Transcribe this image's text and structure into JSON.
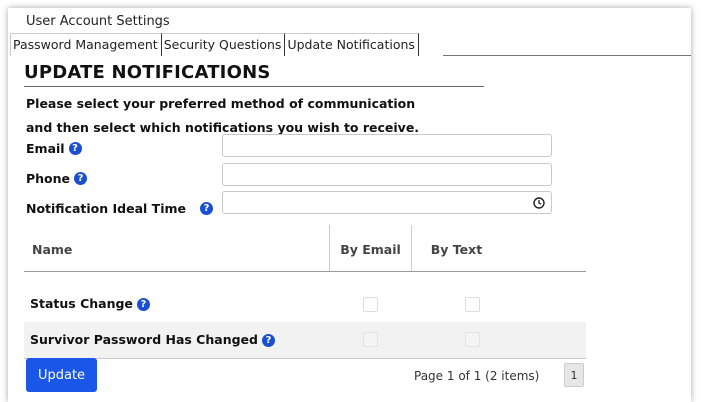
{
  "window": {
    "title": "User Account Settings"
  },
  "tabs": [
    {
      "label": "Password Management"
    },
    {
      "label": "Security Questions"
    },
    {
      "label": "Update Notifications"
    }
  ],
  "section": {
    "heading": "UPDATE NOTIFICATIONS",
    "instructions_line1": "Please select your preferred method of communication",
    "instructions_line2": "and then select which notifications you wish to receive."
  },
  "fields": {
    "email": {
      "label": "Email",
      "value": ""
    },
    "phone": {
      "label": "Phone",
      "value": ""
    },
    "time": {
      "label": "Notification Ideal Time",
      "value": ""
    }
  },
  "table": {
    "columns": [
      "Name",
      "By Email",
      "By Text"
    ],
    "rows": [
      {
        "name": "Status Change",
        "by_email": false,
        "by_text": false
      },
      {
        "name": "Survivor Password Has Changed",
        "by_email": false,
        "by_text": false
      }
    ]
  },
  "actions": {
    "update_label": "Update"
  },
  "pager": {
    "summary": "Page 1 of 1 (2 items)",
    "current_page": "1"
  },
  "colors": {
    "accent": "#1a56e8",
    "help_icon": "#1b4fd1"
  },
  "icons": {
    "help": "question-circle-icon",
    "time": "clock-icon"
  }
}
